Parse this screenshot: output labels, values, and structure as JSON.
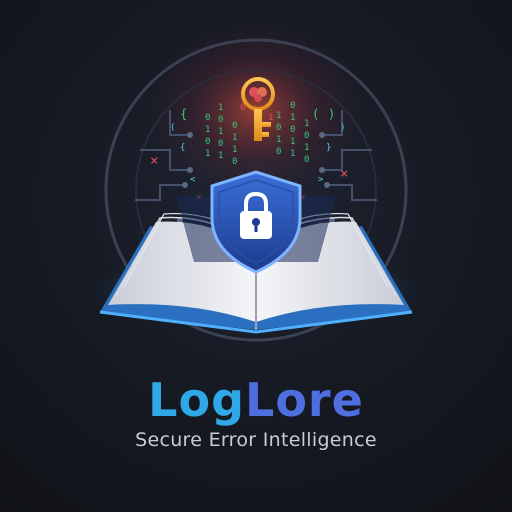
{
  "brand": {
    "name_part_1": "Log",
    "name_part_2": "Lore",
    "tagline": "Secure Error Intelligence"
  },
  "emblem": {
    "icons": [
      "key-icon",
      "brain-icon",
      "shield-icon",
      "padlock-icon",
      "open-book-icon",
      "circuit-ring"
    ],
    "colors": {
      "background": "#14161c",
      "accent_blue": "#2ea8e6",
      "accent_indigo": "#4f6fe0",
      "key_gold": "#f0a030",
      "code_green": "#38c77a",
      "code_red": "#e0505a",
      "code_cyan": "#4fd0e0"
    }
  }
}
